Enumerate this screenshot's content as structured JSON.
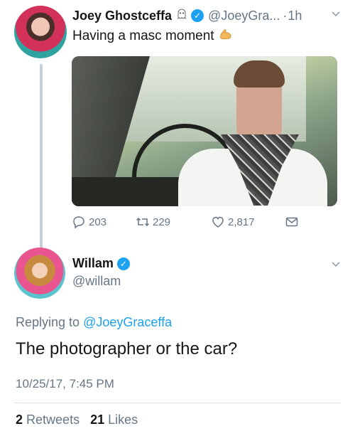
{
  "tweet": {
    "author_name": "Joey Ghostceffa",
    "author_handle": "@JoeyGra...",
    "time_prefix": "·",
    "time": "1h",
    "text": "Having a masc moment",
    "replies": "203",
    "retweets": "229",
    "likes": "2,817"
  },
  "reply": {
    "author_name": "Willam",
    "author_handle": "@willam",
    "replying_prefix": "Replying to",
    "replying_to": "@JoeyGraceffa",
    "text": "The photographer or the car?",
    "timestamp": "10/25/17, 7:45 PM",
    "retweet_count": "2",
    "retweet_label": "Retweets",
    "like_count": "21",
    "like_label": "Likes"
  },
  "icons": {
    "ghost": "ghost-icon",
    "verified": "verified-badge-icon",
    "flex": "flexed-biceps-icon",
    "reply": "reply-icon",
    "retweet": "retweet-icon",
    "like": "heart-icon",
    "dm": "envelope-icon",
    "chevron": "chevron-down-icon"
  },
  "colors": {
    "accent": "#1da1f2",
    "muted": "#657786",
    "text": "#14171a",
    "thread_line": "#c4cfd6"
  }
}
